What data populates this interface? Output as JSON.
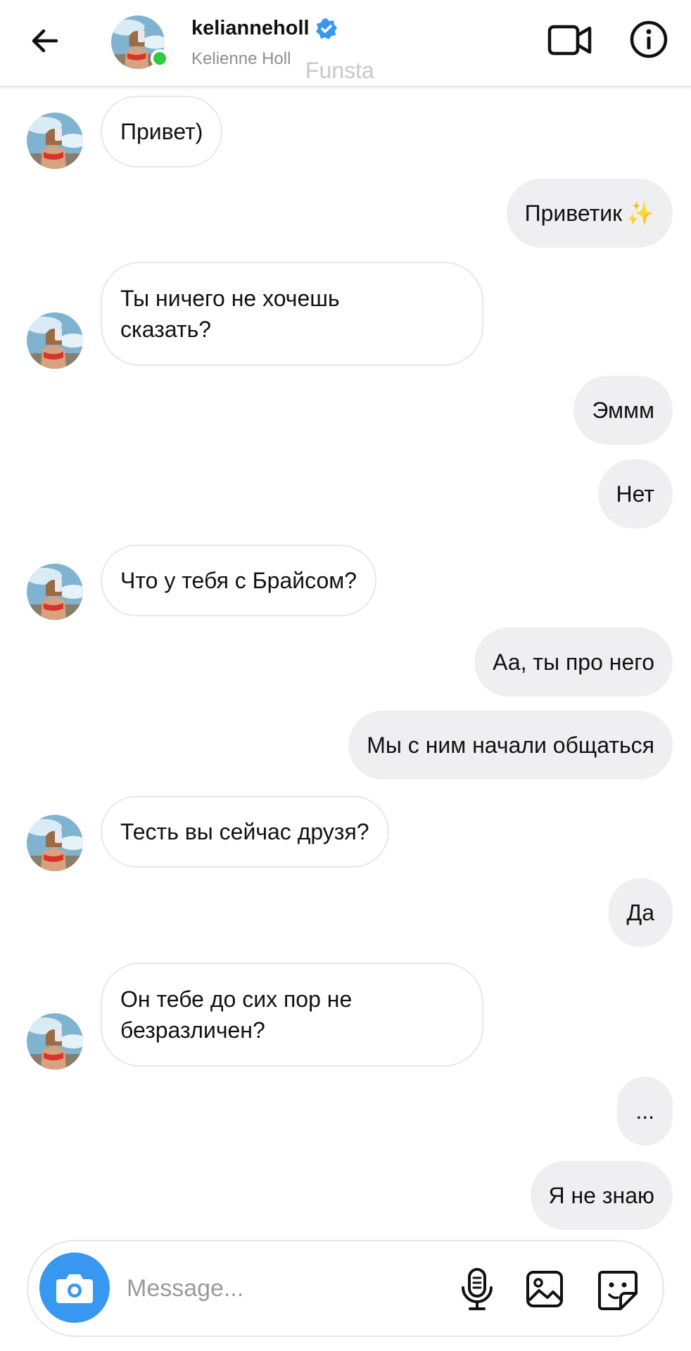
{
  "header": {
    "username": "kelianneholl",
    "display_name": "Kelienne Holl",
    "watermark": "Funsta",
    "verified": true,
    "online": true,
    "colors": {
      "verified": "#3897f0",
      "online": "#2ecc40"
    }
  },
  "messages": [
    {
      "side": "in",
      "text": "Привет)"
    },
    {
      "side": "out",
      "text": "Приветик",
      "emoji": "✨"
    },
    {
      "side": "in",
      "text": "Ты ничего не хочешь\nсказать?"
    },
    {
      "side": "out",
      "text": "Эммм"
    },
    {
      "side": "out",
      "text": "Нет"
    },
    {
      "side": "in",
      "text": "Что у тебя с Брайсом?"
    },
    {
      "side": "out",
      "text": "Аа, ты про него"
    },
    {
      "side": "out",
      "text": "Мы с ним начали общаться"
    },
    {
      "side": "in",
      "text": "Тесть вы сейчас друзя?"
    },
    {
      "side": "out",
      "text": "Да"
    },
    {
      "side": "in",
      "text": "Он тебе до сих пор не\nбезразличен?"
    },
    {
      "side": "out",
      "text": "..."
    },
    {
      "side": "out",
      "text": "Я не знаю"
    }
  ],
  "composer": {
    "placeholder": "Message...",
    "icons": [
      "camera-icon",
      "microphone-icon",
      "gallery-icon",
      "sticker-icon"
    ],
    "colors": {
      "camera_button": "#3897f0"
    }
  },
  "colors": {
    "incoming_bubble_border": "#e8e8e8",
    "outgoing_bubble": "#efeef1"
  }
}
